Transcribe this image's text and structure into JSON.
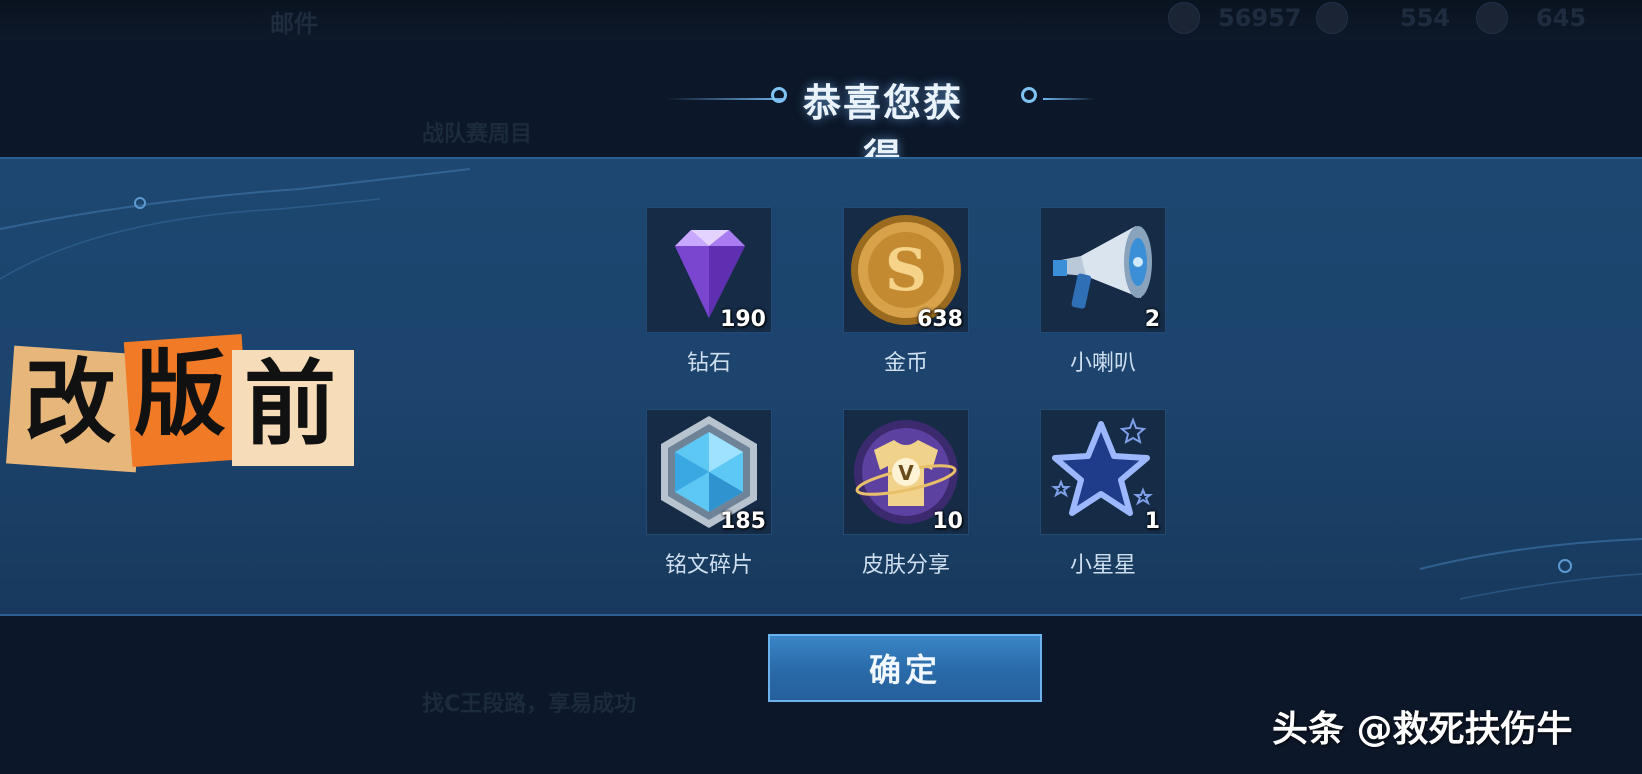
{
  "background": {
    "top_left_label": "邮件",
    "resources": [
      "56957",
      "554",
      "645"
    ],
    "dim_label_1": "战队赛周目",
    "dim_label_2": "找C王段路，享易成功"
  },
  "dialog": {
    "title": "恭喜您获得",
    "items": [
      {
        "name": "钻石",
        "qty": "190",
        "icon": "diamond-icon"
      },
      {
        "name": "金币",
        "qty": "638",
        "icon": "gold-coin-icon"
      },
      {
        "name": "小喇叭",
        "qty": "2",
        "icon": "megaphone-icon"
      },
      {
        "name": "铭文碎片",
        "qty": "185",
        "icon": "inscription-shard-icon"
      },
      {
        "name": "皮肤分享",
        "qty": "10",
        "icon": "skin-share-icon"
      },
      {
        "name": "小星星",
        "qty": "1",
        "icon": "star-icon"
      }
    ],
    "confirm_label": "确定"
  },
  "overlay": {
    "sticker_chars": [
      "改",
      "版",
      "前"
    ]
  },
  "watermark": "头条 @救死扶伤牛",
  "colors": {
    "panel": "#1c446d",
    "button": "#2f78b8",
    "accent": "#6fb7ee"
  }
}
